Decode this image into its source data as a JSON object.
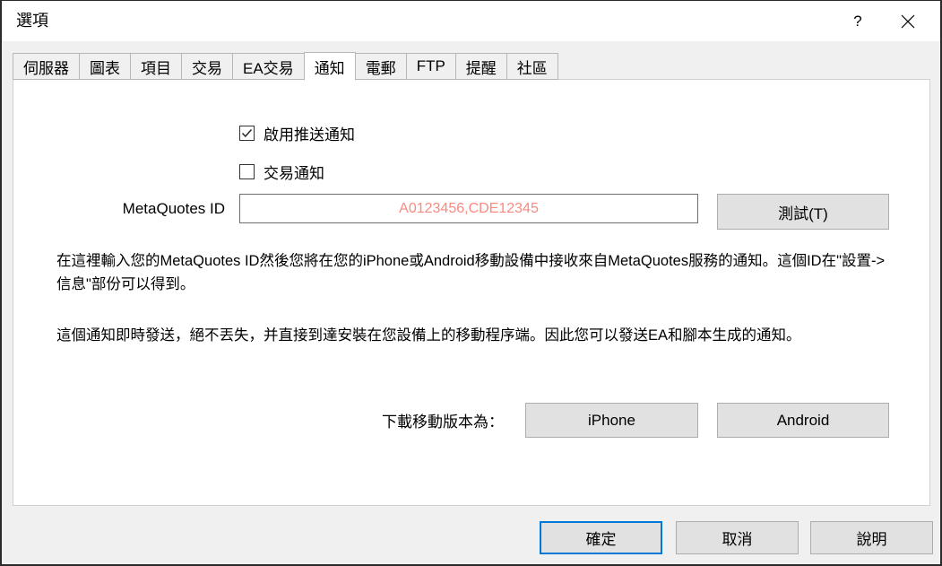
{
  "window": {
    "title": "選項",
    "help_icon": "question-mark-icon",
    "close_icon": "close-icon"
  },
  "tabs": [
    {
      "label": "伺服器",
      "active": false
    },
    {
      "label": "圖表",
      "active": false
    },
    {
      "label": "項目",
      "active": false
    },
    {
      "label": "交易",
      "active": false
    },
    {
      "label": "EA交易",
      "active": false
    },
    {
      "label": "通知",
      "active": true
    },
    {
      "label": "電郵",
      "active": false
    },
    {
      "label": "FTP",
      "active": false
    },
    {
      "label": "提醒",
      "active": false
    },
    {
      "label": "社區",
      "active": false
    }
  ],
  "notifications": {
    "enable_push": {
      "label": "啟用推送通知",
      "checked": true
    },
    "trade_notify": {
      "label": "交易通知",
      "checked": false
    },
    "metaquotes_id": {
      "label": "MetaQuotes ID",
      "value": "",
      "placeholder": "A0123456,CDE12345",
      "placeholder_color": "#fa8a80"
    },
    "test_button": "測試(T)",
    "paragraph_1": "在這裡輸入您的MetaQuotes ID然後您將在您的iPhone或Android移動設備中接收來自MetaQuotes服務的通知。這個ID在\"設置->信息\"部份可以得到。",
    "paragraph_2": "這個通知即時發送，絕不丟失，并直接到達安裝在您設備上的移動程序端。因此您可以發送EA和腳本生成的通知。",
    "download_label": "下載移動版本為：",
    "download_iphone": "iPhone",
    "download_android": "Android"
  },
  "footer": {
    "ok": "確定",
    "cancel": "取消",
    "help": "說明"
  },
  "colors": {
    "accent": "#0078d7",
    "button_face": "#e1e1e1",
    "dialog_bg": "#f0f0f0",
    "panel_bg": "#ffffff"
  }
}
